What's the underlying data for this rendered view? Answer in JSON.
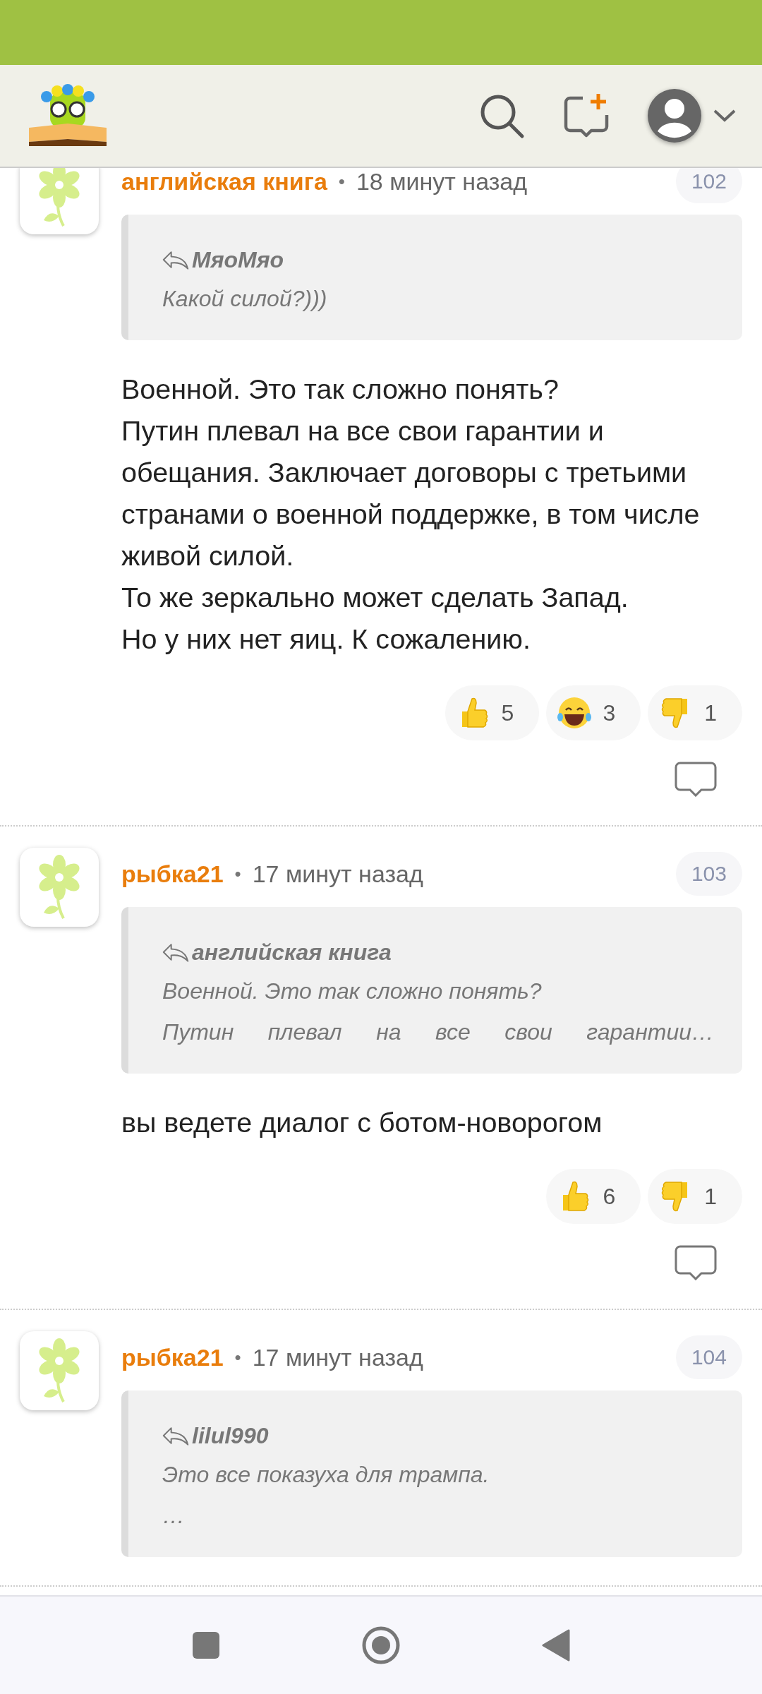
{
  "comments": [
    {
      "author": "английская книга",
      "separator": "•",
      "time": "18 минут назад",
      "number": "102",
      "quote": {
        "author": "МяоМяо",
        "lines": [
          "Какой силой?)))"
        ]
      },
      "body": [
        "Военной. Это так сложно понять?",
        "Путин плевал на все свои гарантии и обещания. Заключает договоры с третьими странами о военной поддержке, в том числе живой силой.",
        "То же зеркально может сделать Запад.",
        "Но у них нет яиц. К сожалению."
      ],
      "reactions": [
        {
          "kind": "thumbs_up",
          "count": "5"
        },
        {
          "kind": "laugh",
          "count": "3"
        },
        {
          "kind": "thumbs_down",
          "count": "1"
        }
      ]
    },
    {
      "author": "рыбка21",
      "separator": "•",
      "time": "17 минут назад",
      "number": "103",
      "quote": {
        "author": "английская книга",
        "lines": [
          "Военной. Это так сложно понять?",
          "Путин плевал на все свои гарантии…"
        ]
      },
      "body": [
        "вы ведете диалог с ботом-новорогом"
      ],
      "reactions": [
        {
          "kind": "thumbs_up",
          "count": "6"
        },
        {
          "kind": "thumbs_down",
          "count": "1"
        }
      ]
    },
    {
      "author": "рыбка21",
      "separator": "•",
      "time": "17 минут назад",
      "number": "104",
      "quote": {
        "author": "lilul990",
        "lines": [
          "Это все показуха для трампа.",
          "…"
        ]
      }
    }
  ]
}
